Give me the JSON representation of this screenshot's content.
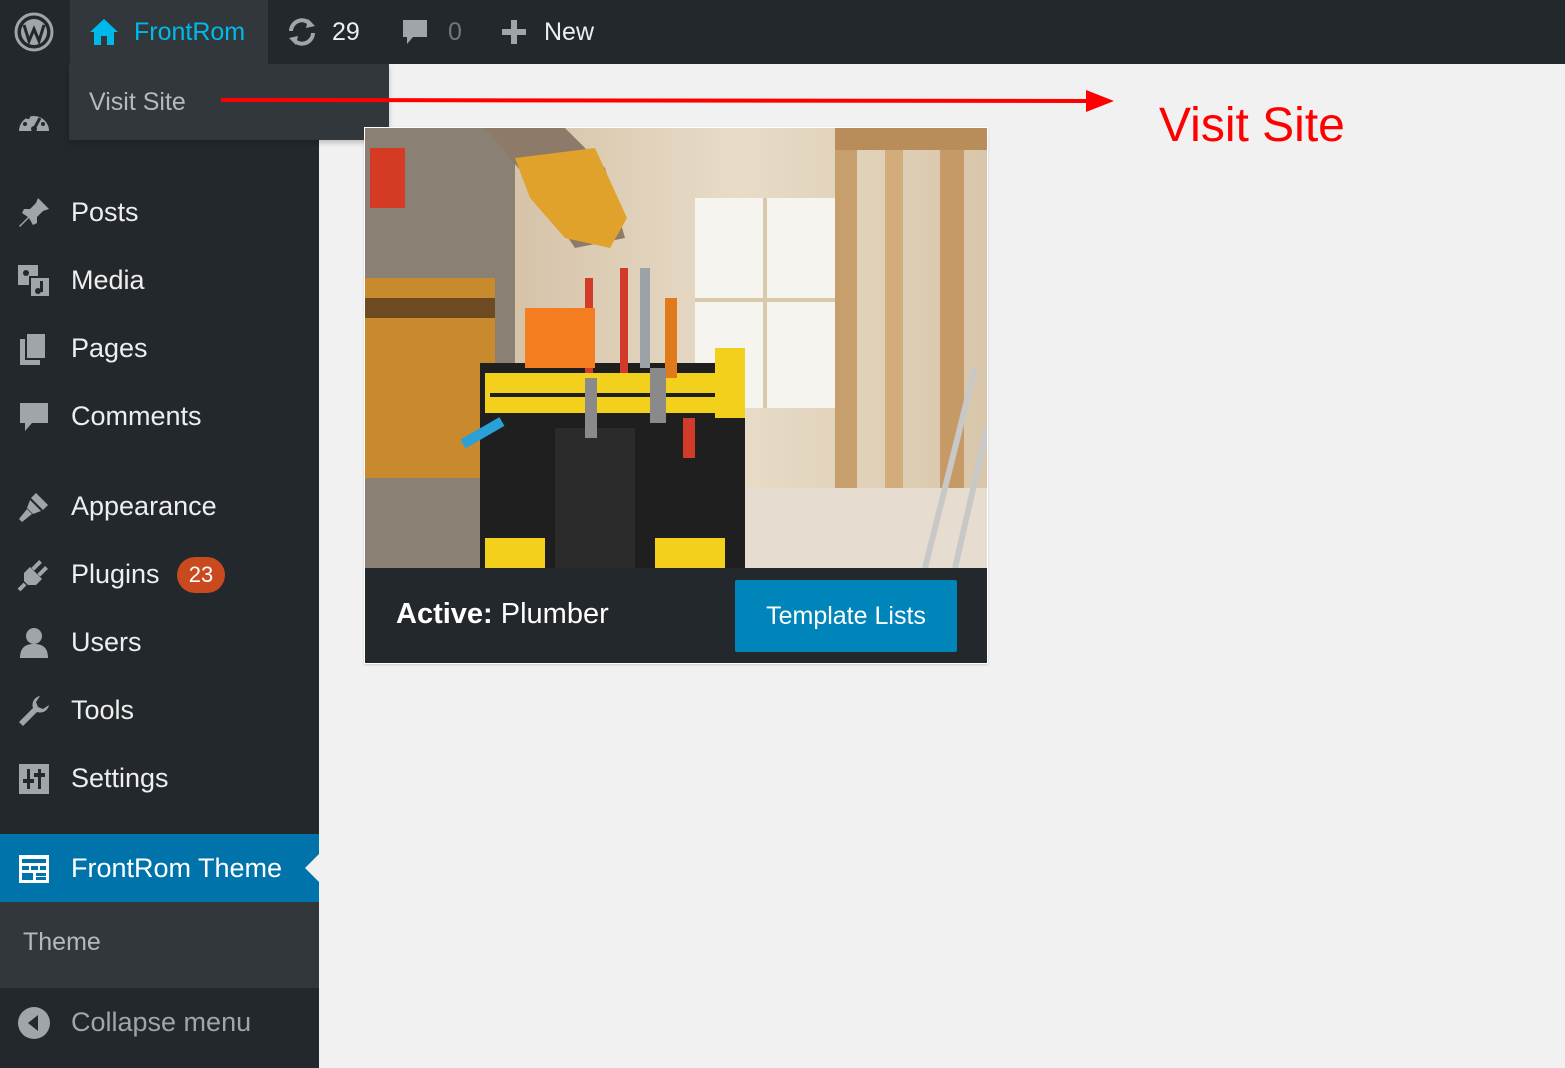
{
  "admin_bar": {
    "site_name": "FrontRom",
    "updates_count": "29",
    "comments_count": "0",
    "new_label": "New",
    "site_dropdown": {
      "visit_site": "Visit Site"
    }
  },
  "sidebar": {
    "items": [
      {
        "label": "Posts",
        "icon": "pushpin-icon"
      },
      {
        "label": "Media",
        "icon": "media-icon"
      },
      {
        "label": "Pages",
        "icon": "pages-icon"
      },
      {
        "label": "Comments",
        "icon": "comment-icon"
      },
      {
        "label": "Appearance",
        "icon": "paintbrush-icon"
      },
      {
        "label": "Plugins",
        "icon": "plugin-icon",
        "badge": "23"
      },
      {
        "label": "Users",
        "icon": "user-icon"
      },
      {
        "label": "Tools",
        "icon": "wrench-icon"
      },
      {
        "label": "Settings",
        "icon": "settings-icon"
      }
    ],
    "active_item": {
      "label": "FrontRom Theme",
      "icon": "theme-layout-icon"
    },
    "submenu": {
      "label": "Theme"
    },
    "collapse": {
      "label": "Collapse menu"
    }
  },
  "theme_card": {
    "active_prefix": "Active:",
    "theme_name": "Plumber",
    "button_label": "Template Lists"
  },
  "annotation": {
    "label": "Visit Site"
  },
  "colors": {
    "adminbar_bg": "#23282d",
    "accent_blue": "#0073aa",
    "button_blue": "#0085ba",
    "site_name_blue": "#00b9eb",
    "badge_orange": "#ca4a1f",
    "annotation_red": "#ff0000"
  }
}
